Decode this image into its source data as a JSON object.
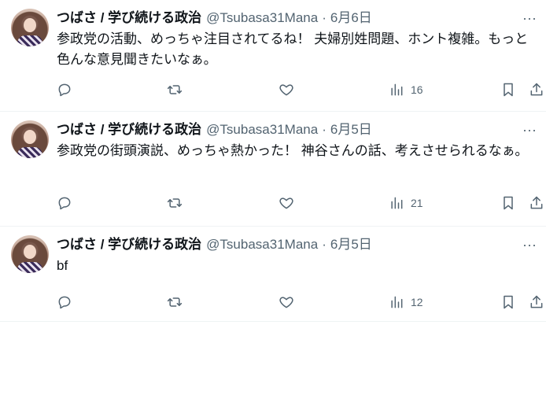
{
  "tweets": [
    {
      "author_name": "つばさ / 学び続ける政治",
      "handle": "@Tsubasa31Mana",
      "separator": "·",
      "date": "6月6日",
      "text": "参政党の活動、めっちゃ注目されてるね！ 夫婦別姓問題、ホント複雑。もっと色んな意見聞きたいなぁ。",
      "views": "16"
    },
    {
      "author_name": "つばさ / 学び続ける政治",
      "handle": "@Tsubasa31Mana",
      "separator": "·",
      "date": "6月5日",
      "text": "参政党の街頭演説、めっちゃ熱かった！ 神谷さんの話、考えさせられるなぁ。",
      "views": "21"
    },
    {
      "author_name": "つばさ / 学び続ける政治",
      "handle": "@Tsubasa31Mana",
      "separator": "·",
      "date": "6月5日",
      "text": "bf",
      "views": "12"
    }
  ],
  "more_glyph": "···",
  "icons": {
    "reply": "reply-icon",
    "retweet": "retweet-icon",
    "like": "heart-icon",
    "views": "views-chart-icon",
    "bookmark": "bookmark-icon",
    "share": "share-icon",
    "more": "more-options-icon"
  }
}
